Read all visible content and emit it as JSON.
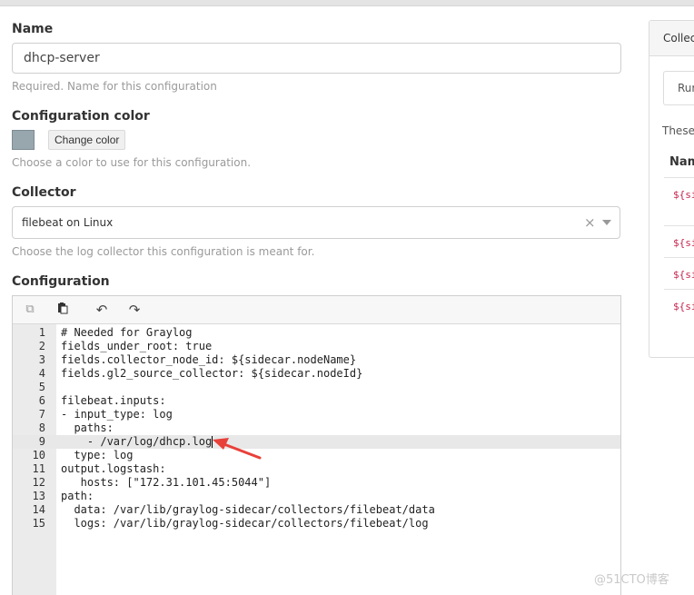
{
  "form": {
    "name": {
      "label": "Name",
      "value": "dhcp-server",
      "help": "Required. Name for this configuration"
    },
    "color": {
      "label": "Configuration color",
      "swatch": "#98a6ae",
      "button_label": "Change color",
      "help": "Choose a color to use for this configuration."
    },
    "collector": {
      "label": "Collector",
      "value": "filebeat on Linux",
      "clear_glyph": "×",
      "help": "Choose the log collector this configuration is meant for."
    },
    "configuration": {
      "label": "Configuration",
      "toolbar": {
        "copy_icon": "⧉",
        "paste_icon": "📋",
        "undo_icon": "↶",
        "redo_icon": "↷"
      },
      "lines": [
        {
          "num": "1",
          "text": "# Needed for Graylog"
        },
        {
          "num": "2",
          "text": "fields_under_root: true"
        },
        {
          "num": "3",
          "text": "fields.collector_node_id: ${sidecar.nodeName}"
        },
        {
          "num": "4",
          "text": "fields.gl2_source_collector: ${sidecar.nodeId}"
        },
        {
          "num": "5",
          "text": ""
        },
        {
          "num": "6",
          "text": "filebeat.inputs:"
        },
        {
          "num": "7",
          "text": "- input_type: log"
        },
        {
          "num": "8",
          "text": "  paths:"
        },
        {
          "num": "9",
          "text": "    - /var/log/dhcp.log"
        },
        {
          "num": "10",
          "text": "  type: log"
        },
        {
          "num": "11",
          "text": "output.logstash:"
        },
        {
          "num": "12",
          "text": "   hosts: [\"172.31.101.45:5044\"]"
        },
        {
          "num": "13",
          "text": "path:"
        },
        {
          "num": "14",
          "text": "  data: /var/lib/graylog-sidecar/collectors/filebeat/data"
        },
        {
          "num": "15",
          "text": "  logs: /var/lib/graylog-sidecar/collectors/filebeat/log"
        }
      ],
      "active_line": 9,
      "annotation_color": "#e8413a"
    }
  },
  "side_panel": {
    "title": "Collec",
    "tab_label": "Rur",
    "text": "These",
    "column_header": "Nam",
    "vars": [
      "${si",
      "${si",
      "${si",
      "${si"
    ]
  },
  "watermark": "@51CTO博客"
}
